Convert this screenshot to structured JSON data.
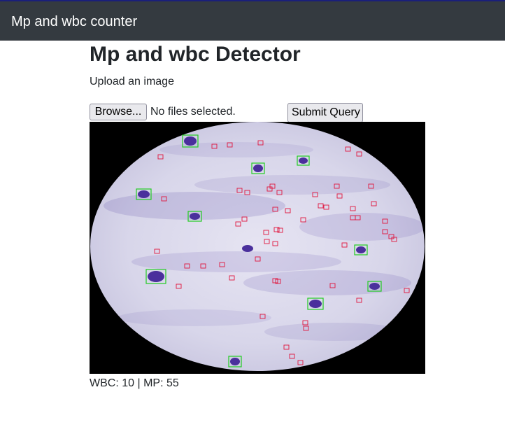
{
  "navbar": {
    "brand": "Mp and wbc counter"
  },
  "main": {
    "title": "Mp and wbc Detector",
    "upload_label": "Upload an image",
    "browse_button": "Browse...",
    "file_status": "No files selected.",
    "submit_button": "Submit Query",
    "counts_text": "WBC: 10 | MP: 55"
  },
  "colors": {
    "navbar_bg": "#343a40",
    "wbc_box": "#22cc22",
    "mp_box": "#e0143c",
    "slide_bg": "#dcdcec",
    "stain": "#5a46a8"
  }
}
